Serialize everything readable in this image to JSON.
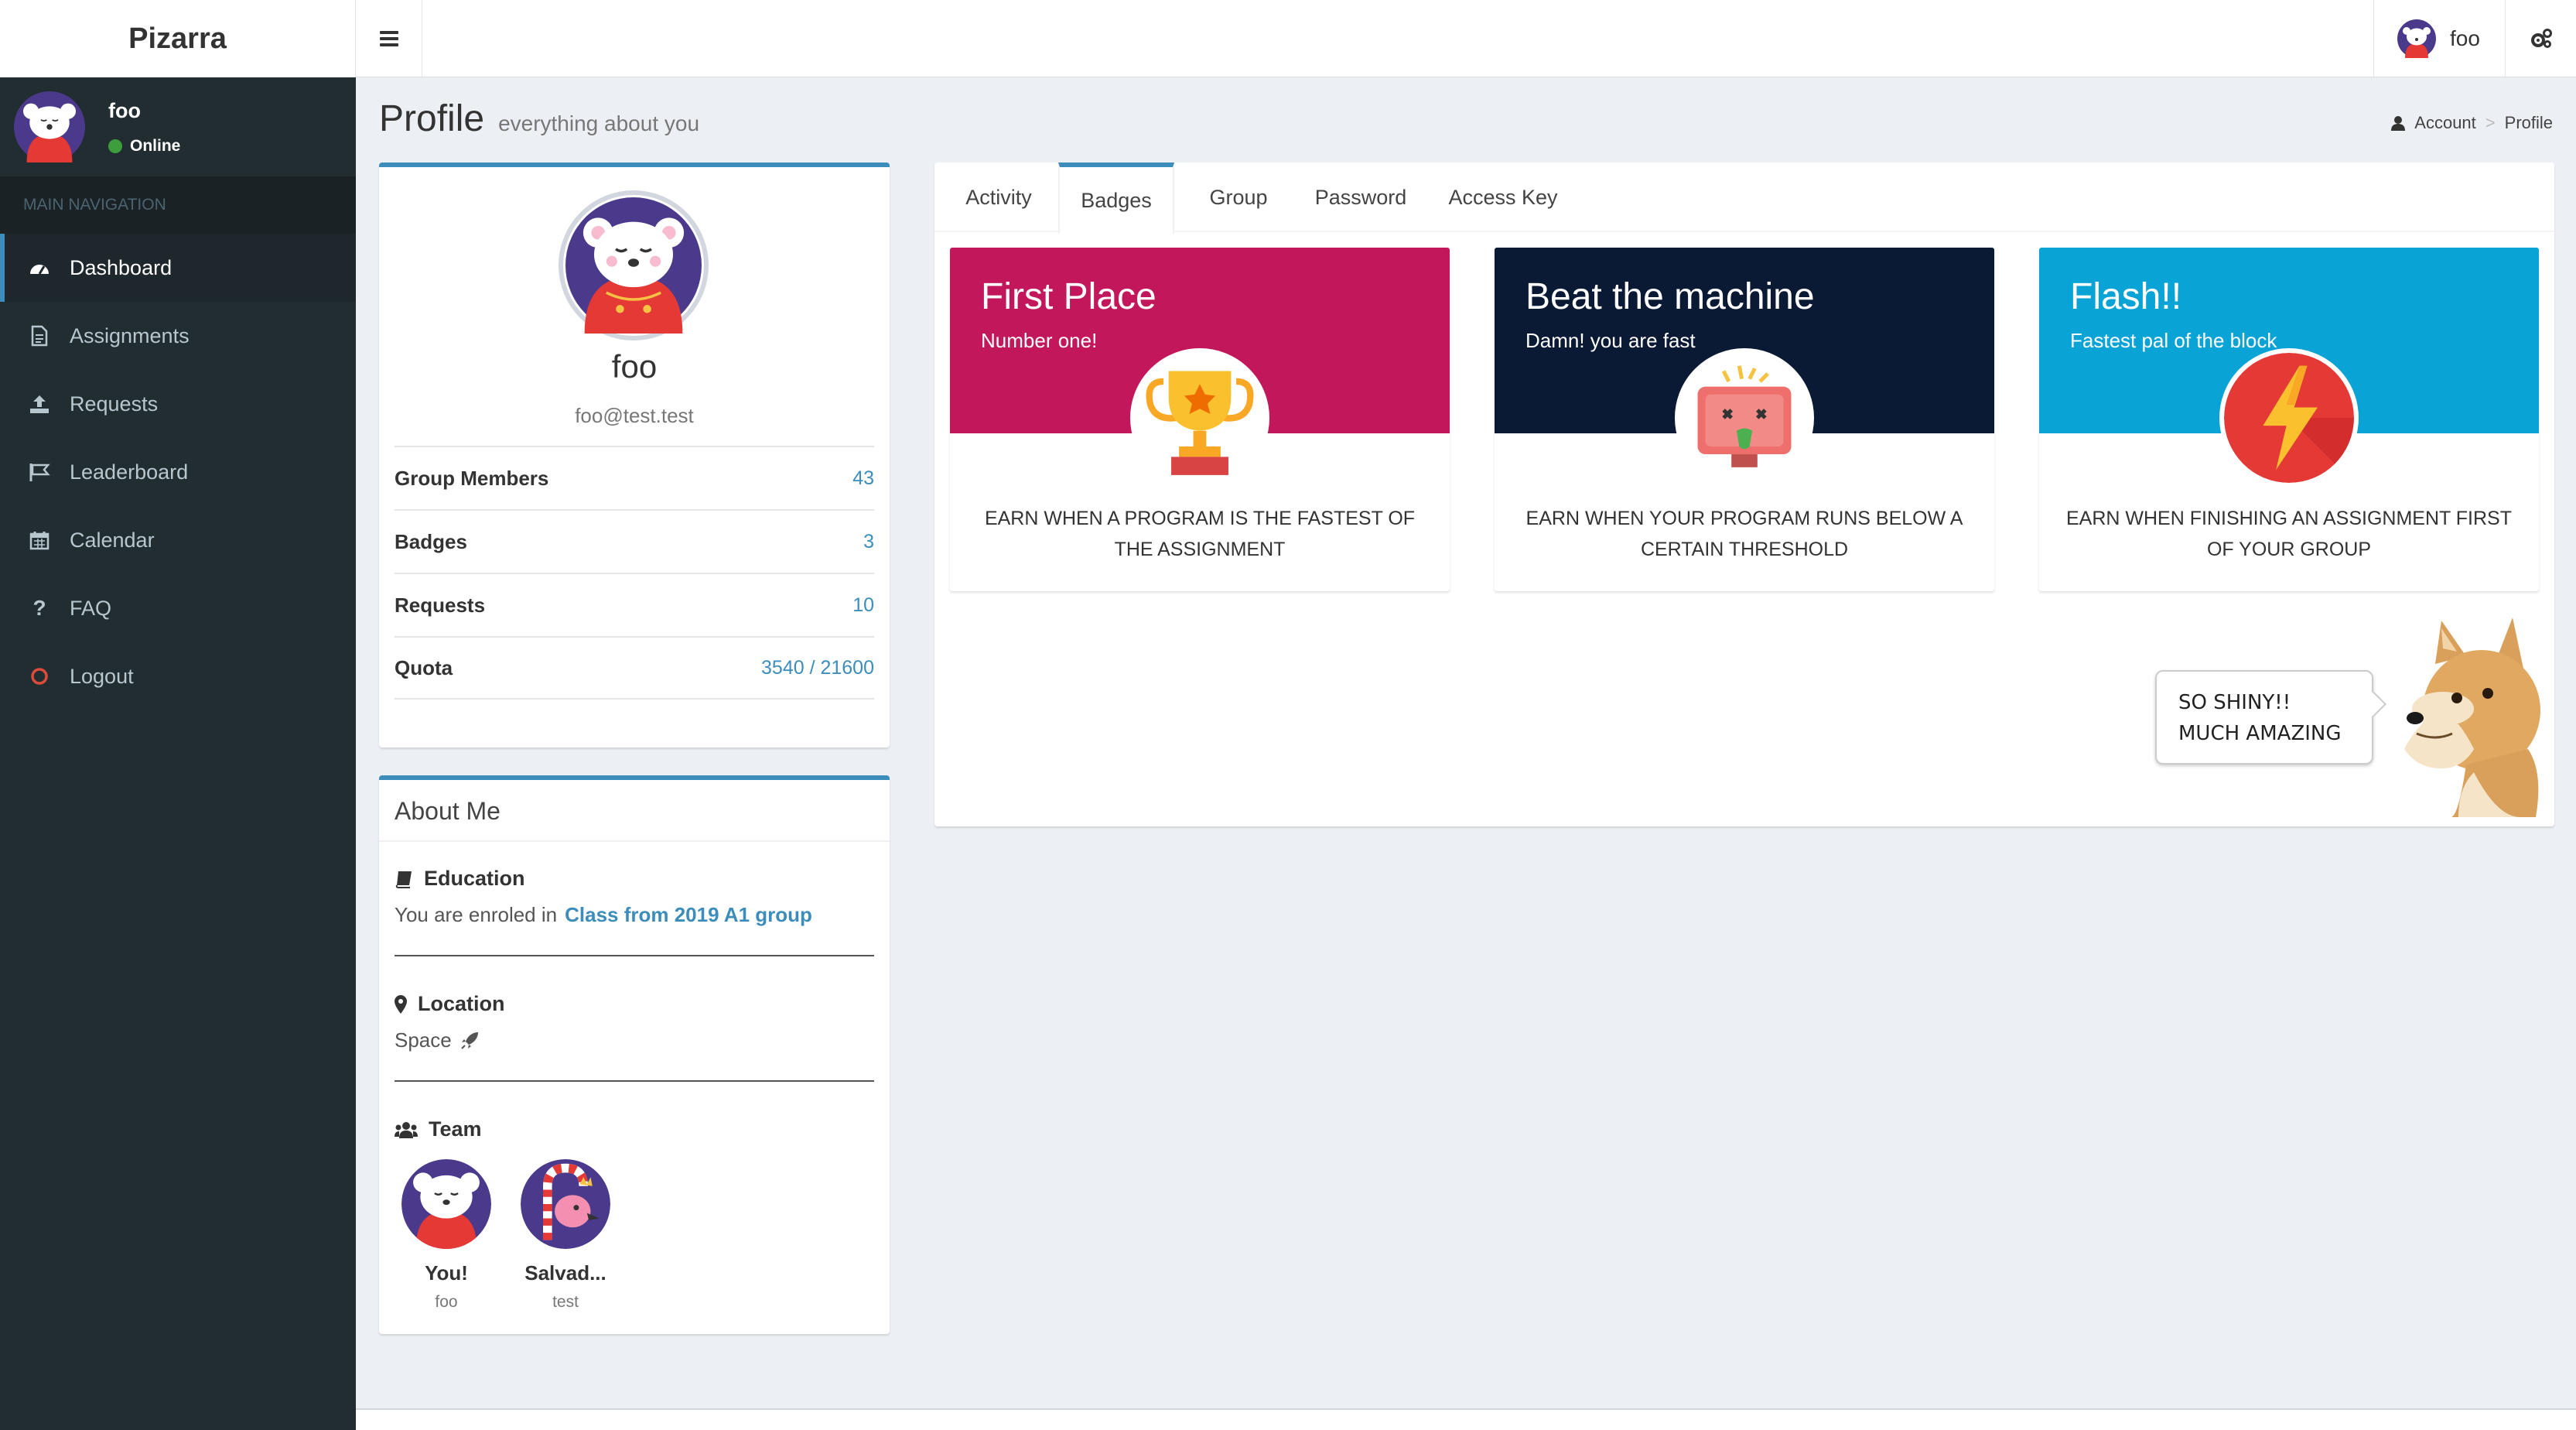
{
  "app": {
    "title": "Pizarra"
  },
  "navbar": {
    "username": "foo"
  },
  "sidebar": {
    "user": {
      "name": "foo",
      "status": "Online"
    },
    "header": "MAIN NAVIGATION",
    "items": [
      {
        "label": "Dashboard",
        "icon": "dashboard-icon"
      },
      {
        "label": "Assignments",
        "icon": "file-icon"
      },
      {
        "label": "Requests",
        "icon": "upload-icon"
      },
      {
        "label": "Leaderboard",
        "icon": "flag-icon"
      },
      {
        "label": "Calendar",
        "icon": "calendar-icon"
      },
      {
        "label": "FAQ",
        "icon": "question-icon"
      },
      {
        "label": "Logout",
        "icon": "circle-icon"
      }
    ]
  },
  "page": {
    "title": "Profile",
    "subtitle": "everything about you"
  },
  "breadcrumb": {
    "items": [
      "Account",
      "Profile"
    ]
  },
  "profile": {
    "name": "foo",
    "email": "foo@test.test",
    "stats": [
      {
        "label": "Group Members",
        "value": "43"
      },
      {
        "label": "Badges",
        "value": "3"
      },
      {
        "label": "Requests",
        "value": "10"
      },
      {
        "label": "Quota",
        "value": "3540 / 21600"
      }
    ]
  },
  "about": {
    "title": "About Me",
    "education": {
      "label": "Education",
      "text": "You are enroled in",
      "group": "Class from 2019 A1 group"
    },
    "location": {
      "label": "Location",
      "text": "Space"
    },
    "team": {
      "label": "Team",
      "members": [
        {
          "name": "You!",
          "username": "foo"
        },
        {
          "name": "Salvad...",
          "username": "test"
        }
      ]
    }
  },
  "tabs": [
    {
      "label": "Activity",
      "active": false
    },
    {
      "label": "Badges",
      "active": true
    },
    {
      "label": "Group",
      "active": false
    },
    {
      "label": "Password",
      "active": false
    },
    {
      "label": "Access Key",
      "active": false
    }
  ],
  "badges": [
    {
      "title": "First Place",
      "subtitle": "Number one!",
      "description": "Earn when a program is the fastest of the assignment",
      "color": "#c2185b"
    },
    {
      "title": "Beat the machine",
      "subtitle": "Damn! you are fast",
      "description": "Earn when your program runs below a certain threshold",
      "color": "#0b1a34"
    },
    {
      "title": "Flash!!",
      "subtitle": "Fastest pal of the block",
      "description": "Earn when finishing an assignment first of your group",
      "color": "#0aa3d6"
    }
  ],
  "doge": {
    "line1": "SO SHINY!!",
    "line2": "MUCH AMAZING"
  },
  "colors": {
    "sidebar": "#222d32",
    "accent": "#3c8dbc",
    "background": "#ecf0f5"
  }
}
